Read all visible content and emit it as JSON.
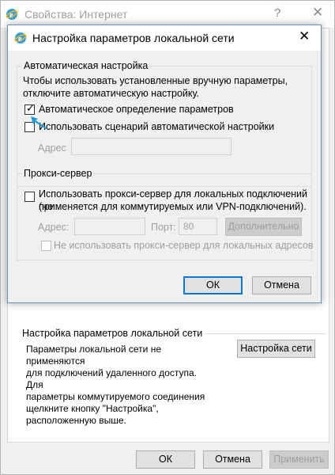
{
  "background_window": {
    "title": "Свойства: Интернет",
    "help_icon": "?",
    "close_icon": "✕",
    "lan_group_title": "Настройка параметров локальной сети",
    "lan_description": "Параметры локальной сети не применяются\nдля подключений удаленного доступа. Для\nпараметры коммутируемого соединения\nщелкните кнопку \"Настройка\",\nрасположенную выше.",
    "lan_settings_button": "Настройка сети",
    "ok_button": "ОК",
    "cancel_button": "Отмена",
    "apply_button": "Применить"
  },
  "dialog": {
    "title": "Настройка параметров локальной сети",
    "close_icon": "✕",
    "auto_config": {
      "group_title": "Автоматическая настройка",
      "description": "Чтобы использовать установленные вручную параметры,\nотключите автоматическую настройку.",
      "auto_detect_label": "Автоматическое определение параметров",
      "auto_detect_checked": true,
      "use_script_label": "Использовать сценарий автоматической настройки",
      "use_script_checked": false,
      "address_label": "Адрес",
      "address_value": ""
    },
    "proxy": {
      "group_title": "Прокси-сервер",
      "use_proxy_label_line1": "Использовать прокси-сервер для локальных подключений (не",
      "use_proxy_label_line2": "применяется для коммутируемых или VPN-подключений).",
      "use_proxy_checked": false,
      "address_label": "Адрес:",
      "address_value": "",
      "port_label": "Порт:",
      "port_value": "80",
      "advanced_button": "Дополнительно",
      "bypass_local_label": "Не использовать прокси-сервер для локальных адресов",
      "bypass_local_checked": false
    },
    "ok_button": "ОК",
    "cancel_button": "Отмена"
  },
  "colors": {
    "accent": "#0078d7",
    "pointer_arrow": "#1c9ad6"
  },
  "icons": {
    "app": "internet-explorer-icon",
    "checkmark": "checkmark-icon",
    "pointer": "pointer-arrow-icon"
  }
}
